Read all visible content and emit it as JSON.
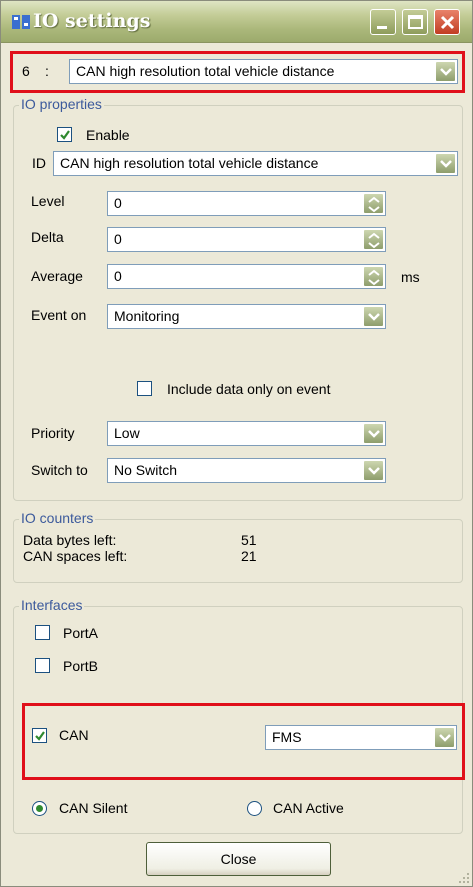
{
  "window": {
    "title": "IO settings"
  },
  "header": {
    "index": "6",
    "separator": ":",
    "selected_io": "CAN high resolution total vehicle distance"
  },
  "io_properties": {
    "title": "IO properties",
    "enable_label": "Enable",
    "enable_checked": true,
    "id_label": "ID",
    "id_value": "CAN high resolution total vehicle distance",
    "level_label": "Level",
    "level_value": "0",
    "delta_label": "Delta",
    "delta_value": "0",
    "average_label": "Average",
    "average_value": "0",
    "average_unit": "ms",
    "event_on_label": "Event on",
    "event_on_value": "Monitoring",
    "include_label": "Include data only on event",
    "include_checked": false,
    "priority_label": "Priority",
    "priority_value": "Low",
    "switch_to_label": "Switch to",
    "switch_to_value": "No Switch"
  },
  "io_counters": {
    "title": "IO counters",
    "data_bytes_label": "Data bytes left:",
    "data_bytes_value": "51",
    "can_spaces_label": "CAN spaces left:",
    "can_spaces_value": "21"
  },
  "interfaces": {
    "title": "Interfaces",
    "porta_label": "PortA",
    "porta_checked": false,
    "portb_label": "PortB",
    "portb_checked": false,
    "can_label": "CAN",
    "can_checked": true,
    "can_mode_value": "FMS",
    "can_silent_label": "CAN Silent",
    "can_silent_selected": true,
    "can_active_label": "CAN Active",
    "can_active_selected": false
  },
  "footer": {
    "close_label": "Close"
  },
  "colors": {
    "highlight": "#e0101a",
    "group_title": "#3c5a9c",
    "check": "#2f8a2f"
  }
}
